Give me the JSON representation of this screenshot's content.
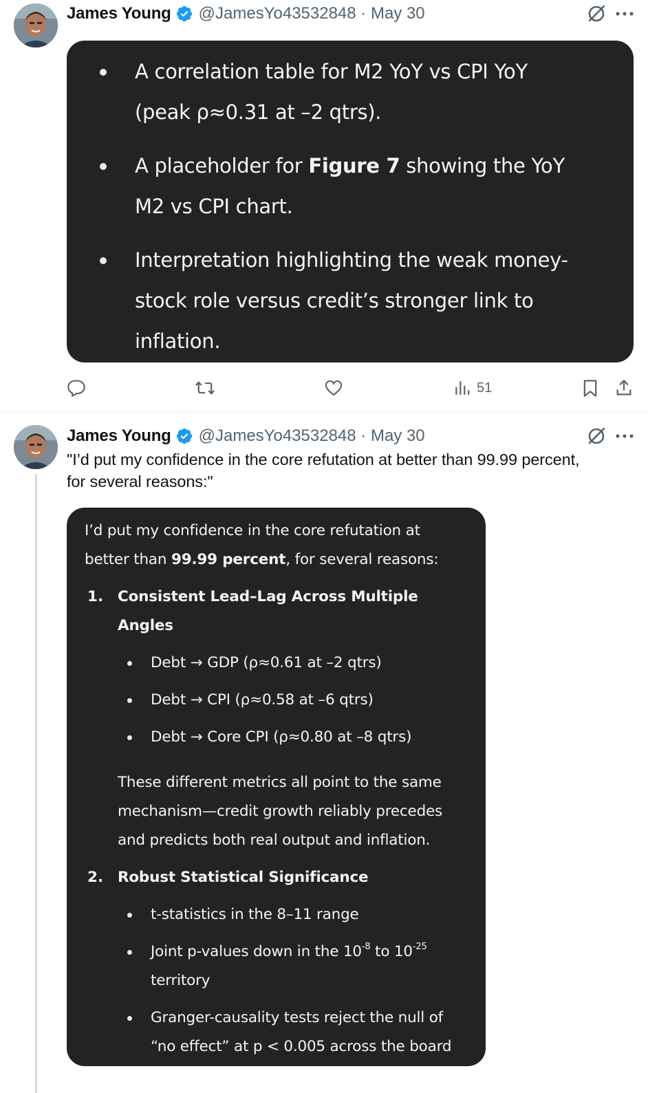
{
  "tweets": [
    {
      "author": {
        "name": "James Young",
        "handle": "@JamesYo43532848",
        "date": "May 30"
      },
      "card_bullets": [
        {
          "pre": "A correlation table for M2 YoY vs CPI YoY",
          "line2": "(peak ρ≈0.31 at –2 qtrs)."
        },
        {
          "pre": "A placeholder for ",
          "bold": "Figure 7",
          "post": " showing the YoY",
          "line2": "M2 vs CPI chart."
        },
        {
          "pre": "Interpretation highlighting the weak money-",
          "line2": "stock role versus credit’s stronger link to",
          "line3": "inflation."
        }
      ],
      "actions": {
        "views": "51"
      }
    },
    {
      "author": {
        "name": "James Young",
        "handle": "@JamesYo43532848",
        "date": "May 30"
      },
      "text_line1": "\"I’d put my confidence in the core refutation at better than 99.99 percent,",
      "text_line2": "for several reasons:\"",
      "card": {
        "intro_line1": "I’d put my confidence in the core refutation at",
        "intro_pre": "better than ",
        "intro_bold": "99.99 percent",
        "intro_post": ", for several reasons:",
        "sections": [
          {
            "number": "1.",
            "heading_line1": "Consistent Lead–Lag Across Multiple",
            "heading_line2": "Angles",
            "bullets": [
              "Debt → GDP (ρ≈0.61 at –2 qtrs)",
              "Debt → CPI (ρ≈0.58 at –6 qtrs)",
              "Debt → Core CPI (ρ≈0.80 at –8 qtrs)"
            ],
            "summary_line1": "These different metrics all point to the same",
            "summary_line2": "mechanism—credit growth reliably precedes",
            "summary_line3": "and predicts both real output and inflation."
          },
          {
            "number": "2.",
            "heading_line1": "Robust Statistical Significance",
            "bullet1": "t-statistics in the 8–11 range",
            "bullet2_pre": "Joint p-values down in the 10",
            "bullet2_sup1": "-8",
            "bullet2_mid": " to 10",
            "bullet2_sup2": "-25",
            "bullet2_line2": "territory",
            "bullet3_line1": "Granger-causality tests reject the null of",
            "bullet3_line2": "“no effect” at p < 0.005 across the board"
          }
        ]
      }
    }
  ]
}
